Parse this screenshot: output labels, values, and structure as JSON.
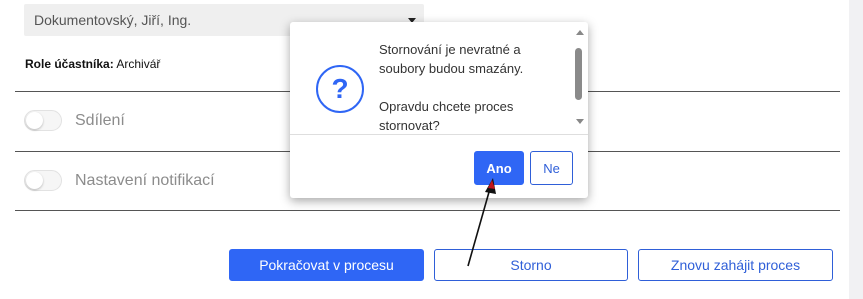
{
  "participant_select": {
    "value": "Dokumentovský, Jiří, Ing."
  },
  "role": {
    "label": "Role účastníka:",
    "value": "Archivář"
  },
  "toggles": [
    {
      "label": "Sdílení"
    },
    {
      "label": "Nastavení notifikací"
    }
  ],
  "actions": {
    "continue_label": "Pokračovat v procesu",
    "cancel_label": "Storno",
    "restart_label": "Znovu zahájit proces"
  },
  "dialog": {
    "icon": "question-icon",
    "message_line1": "Stornování je nevratné a soubory budou smazány.",
    "message_line2": "Opravdu chcete proces stornovat?",
    "yes_label": "Ano",
    "no_label": "Ne"
  },
  "colors": {
    "primary": "#2f66f5",
    "outline": "#2f5fd8"
  }
}
